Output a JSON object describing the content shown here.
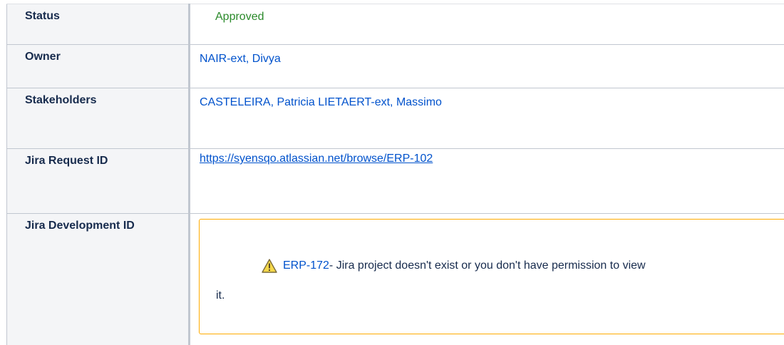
{
  "properties": {
    "status": {
      "label": "Status",
      "value": "Approved",
      "color": "#2b8a2b"
    },
    "owner": {
      "label": "Owner",
      "value": "NAIR-ext, Divya"
    },
    "stakeholders": {
      "label": "Stakeholders",
      "users": [
        "CASTELEIRA, Patricia",
        "LIETAERT-ext, Massimo"
      ]
    },
    "jira_request": {
      "label": "Jira Request ID",
      "url": "https://syensqo.atlassian.net/browse/ERP-102"
    },
    "jira_development": {
      "label": "Jira Development ID",
      "warning": {
        "icon": "warning-triangle-icon",
        "issue_key": "ERP-172",
        "message_part1": " - Jira project doesn't exist or you don't have permission to view",
        "message_part2": "it."
      }
    }
  },
  "colors": {
    "link": "#0052cc",
    "header_bg": "#f4f5f7",
    "border": "#c1c7d0",
    "warning_border": "#ffab00"
  }
}
